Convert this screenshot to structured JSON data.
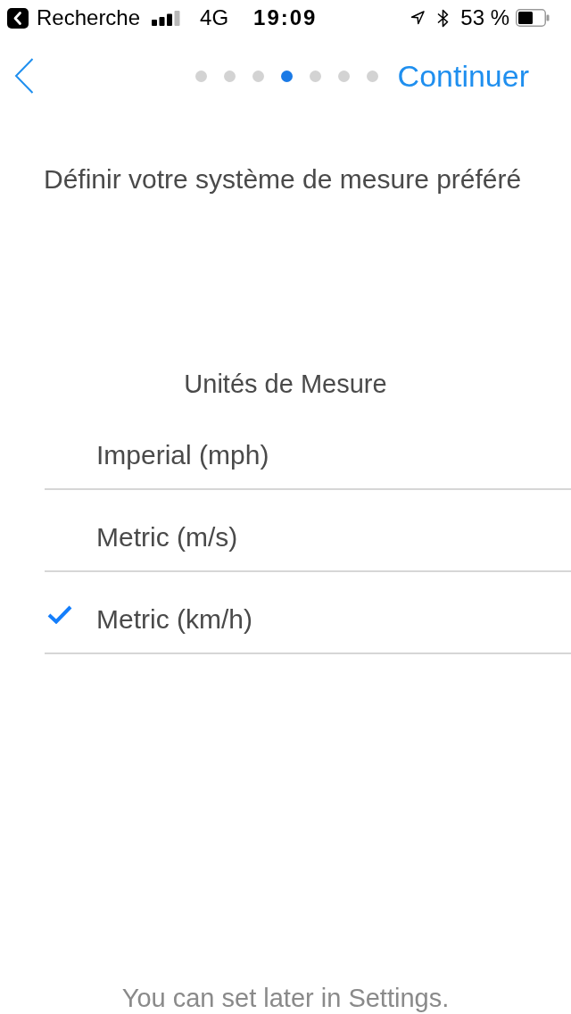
{
  "status_bar": {
    "back_app": "Recherche",
    "network": "4G",
    "time": "19:09",
    "battery": "53 %"
  },
  "nav": {
    "steps": [
      {
        "selected": false
      },
      {
        "selected": false
      },
      {
        "selected": false
      },
      {
        "selected": true
      },
      {
        "selected": false
      },
      {
        "selected": false
      },
      {
        "selected": false
      }
    ],
    "continue_label": "Continuer"
  },
  "title": "Définir votre système de mesure préféré",
  "units": {
    "heading": "Unités de Mesure",
    "options": [
      {
        "label": "Imperial (mph)",
        "selected": false
      },
      {
        "label": "Metric (m/s)",
        "selected": false
      },
      {
        "label": "Metric (km/h)",
        "selected": true
      }
    ]
  },
  "footer": "You can set later in Settings."
}
